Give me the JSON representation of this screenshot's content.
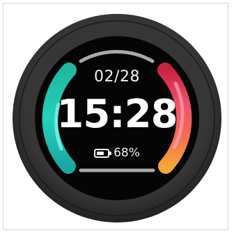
{
  "watch": {
    "date": "02/28",
    "time": "15:28",
    "battery": {
      "percent_label": "68%",
      "level": 0.68
    }
  },
  "colors": {
    "bezel": "#2e2e2e",
    "face": "#050505",
    "track": "#a9a9a9",
    "left_arc": "#1ec6b0",
    "right_arc_top": "#e0304e",
    "right_arc_bottom": "#f5a033"
  },
  "icons": {
    "battery": "battery-icon"
  }
}
